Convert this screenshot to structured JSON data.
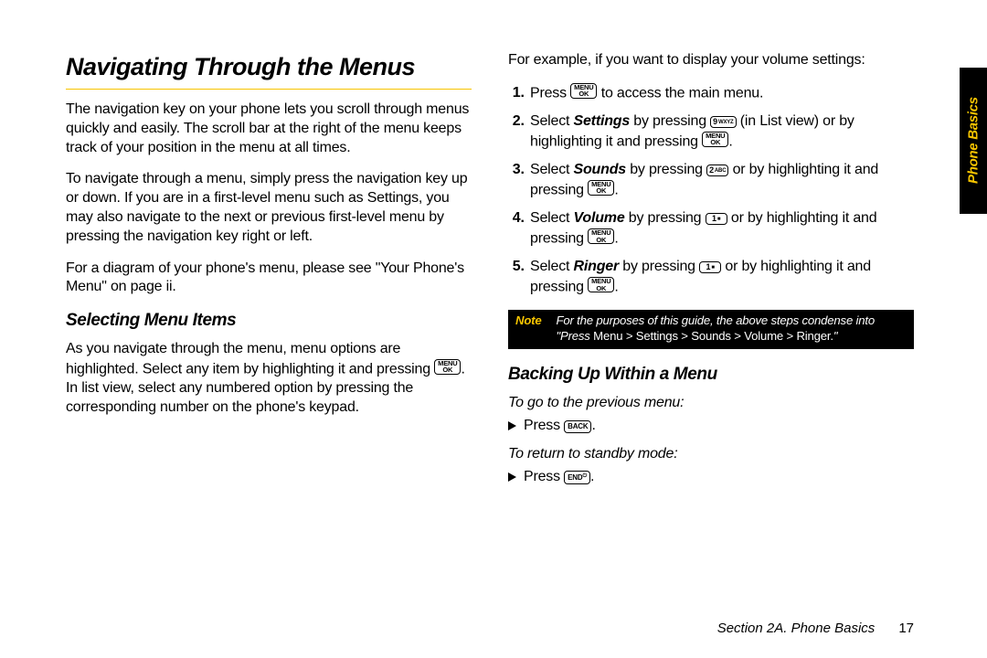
{
  "sideTab": "Phone Basics",
  "footer": {
    "section": "Section 2A. Phone Basics",
    "page": "17"
  },
  "keys": {
    "menuOk": {
      "line1": "MENU",
      "line2": "OK"
    },
    "back": "BACK",
    "end": "END",
    "k1": {
      "n": "1",
      "t": "■"
    },
    "k2": {
      "n": "2",
      "t": "ABC"
    },
    "k9": {
      "n": "9",
      "t": "WXYZ"
    }
  },
  "left": {
    "title": "Navigating Through the Menus",
    "p1": "The navigation key on your phone lets you scroll through menus quickly and easily. The scroll bar at the right of the menu keeps track of your position in the menu at all times.",
    "p2": "To navigate through a menu, simply press the navigation key up or down. If you are in a first-level menu such as Settings, you may also navigate to the next or previous first-level menu by pressing the navigation key right or left.",
    "p3": "For a diagram of your phone's menu, please see \"Your Phone's Menu\" on page ii.",
    "sub1": "Selecting Menu Items",
    "p4a": "As you navigate through the menu, menu options are highlighted. Select any item by highlighting it and pressing ",
    "p4b": ". In list view, select any numbered option by pressing the corresponding number on the phone's keypad."
  },
  "right": {
    "intro": "For example, if you want to display your volume settings:",
    "s1a": "Press ",
    "s1b": " to access the main menu.",
    "s2a": "Select ",
    "s2bold": "Settings",
    "s2b": " by pressing ",
    "s2c": " (in List view) or by highlighting it and pressing ",
    "s2d": ".",
    "s3a": "Select ",
    "s3bold": "Sounds",
    "s3b": " by pressing ",
    "s3c": " or by highlighting it and pressing ",
    "s3d": ".",
    "s4a": "Select ",
    "s4bold": "Volume",
    "s4b": " by pressing ",
    "s4c": " or by highlighting it and pressing ",
    "s4d": ".",
    "s5a": "Select ",
    "s5bold": "Ringer",
    "s5b": " by pressing ",
    "s5c": " or by highlighting it and pressing ",
    "s5d": ".",
    "noteLabel": "Note",
    "noteA": "For the purposes of this guide, the above steps condense into \"Press ",
    "notePath": "Menu > Settings > Sounds > Volume > Ringer.",
    "noteB": "\"",
    "sub2": "Backing Up Within a Menu",
    "instr1": "To go to the previous menu:",
    "b1a": "Press ",
    "b1b": ".",
    "instr2": "To return to standby mode:",
    "b2a": "Press ",
    "b2b": "."
  }
}
